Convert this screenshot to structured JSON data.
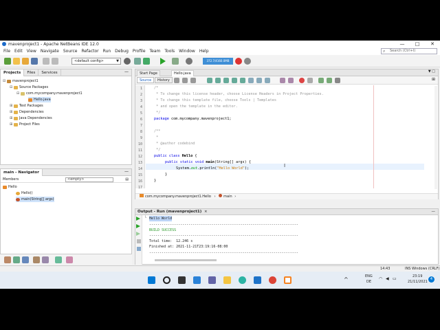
{
  "window": {
    "title": "mavenproject1 - Apache NetBeans IDE 12.0",
    "controls": [
      "—",
      "□",
      "✕"
    ]
  },
  "menu": [
    "File",
    "Edit",
    "View",
    "Navigate",
    "Source",
    "Refactor",
    "Run",
    "Debug",
    "Profile",
    "Team",
    "Tools",
    "Window",
    "Help"
  ],
  "search": {
    "placeholder": "Search (Ctrl+I)"
  },
  "toolbar": {
    "config": "<default config>",
    "memory": "372.7/4160.0MB"
  },
  "projects_panel": {
    "tabs": [
      "Projects",
      "Files",
      "Services"
    ],
    "tree": [
      {
        "label": "mavenproject1",
        "expander": "⊟",
        "icon": "project"
      },
      {
        "label": "Source Packages",
        "expander": "⊟",
        "icon": "folder"
      },
      {
        "label": "com.mycompany.mavenproject1",
        "expander": "⊟",
        "icon": "package"
      },
      {
        "label": "Hello.java",
        "expander": "",
        "icon": "java-file"
      },
      {
        "label": "Test Packages",
        "expander": "⊞",
        "icon": "folder"
      },
      {
        "label": "Dependencies",
        "expander": "⊞",
        "icon": "folder"
      },
      {
        "label": "Java Dependencies",
        "expander": "⊞",
        "icon": "folder"
      },
      {
        "label": "Project Files",
        "expander": "⊞",
        "icon": "folder"
      }
    ]
  },
  "navigator": {
    "title": "main - Navigator",
    "members_label": "Members",
    "filter": "<empty>",
    "tree": [
      {
        "label": "Hello"
      },
      {
        "label": "Hello()"
      },
      {
        "label": "main(String[] args)"
      }
    ]
  },
  "editor": {
    "tabs": [
      "Start Page",
      "Hello.java"
    ],
    "source_btn": "Source",
    "history_btn": "History",
    "line_numbers": [
      "1",
      "2",
      "3",
      "4",
      "5",
      "6",
      "7",
      "8",
      "9",
      "10",
      "11",
      "12",
      "13",
      "14",
      "15",
      "16",
      "17"
    ],
    "code": {
      "l1": "/*",
      "l2": " * To change this license header, choose License Headers in Project Properties.",
      "l3": " * To change this template file, choose Tools | Templates",
      "l4": " * and open the template in the editor.",
      "l5": " */",
      "l6_kw": "package",
      "l6_rest": " com.mycompany.mavenproject1;",
      "l8": "/**",
      "l9": " *",
      "l10": " * @author codebind",
      "l11": " */",
      "l12_kw": "public class",
      "l12_name": " Hello",
      "l12_rest": " {",
      "l13_kw": "public static void",
      "l13_name": " main",
      "l13_rest": "(String[] args) {",
      "l14_a": "System.",
      "l14_fld": "out",
      "l14_b": ".",
      "l14_fn": "println",
      "l14_c": "(",
      "l14_str": "\"Hello World\"",
      "l14_d": ");",
      "l15": "}",
      "l16": "}"
    },
    "breadcrumb": [
      "com.mycompany.mavenproject1.Hello",
      "main"
    ]
  },
  "output": {
    "tab": "Output - Run (mavenproject1)",
    "lines": {
      "hello": "Hello World",
      "sep1": "------------------------------------------------------------------------",
      "build": "BUILD SUCCESS",
      "sep2": "------------------------------------------------------------------------",
      "time": "Total time:  12.246 s",
      "finished": "Finished at: 2021-11-21T23:19:16-08:00",
      "sep3": "------------------------------------------------------------------------"
    }
  },
  "statusbar": {
    "position": "14:43",
    "mode": "INS Windows (CRLF)"
  },
  "taskbar": {
    "lang1": "ENG",
    "lang2": "DE",
    "time": "23:19",
    "date": "21/11/2021",
    "notifications": "4"
  },
  "colors": {
    "accent": "#1b6ac9",
    "keyword": "#0000e6",
    "comment": "#969696",
    "string": "#ce7b00",
    "success": "#2a9a2a"
  }
}
